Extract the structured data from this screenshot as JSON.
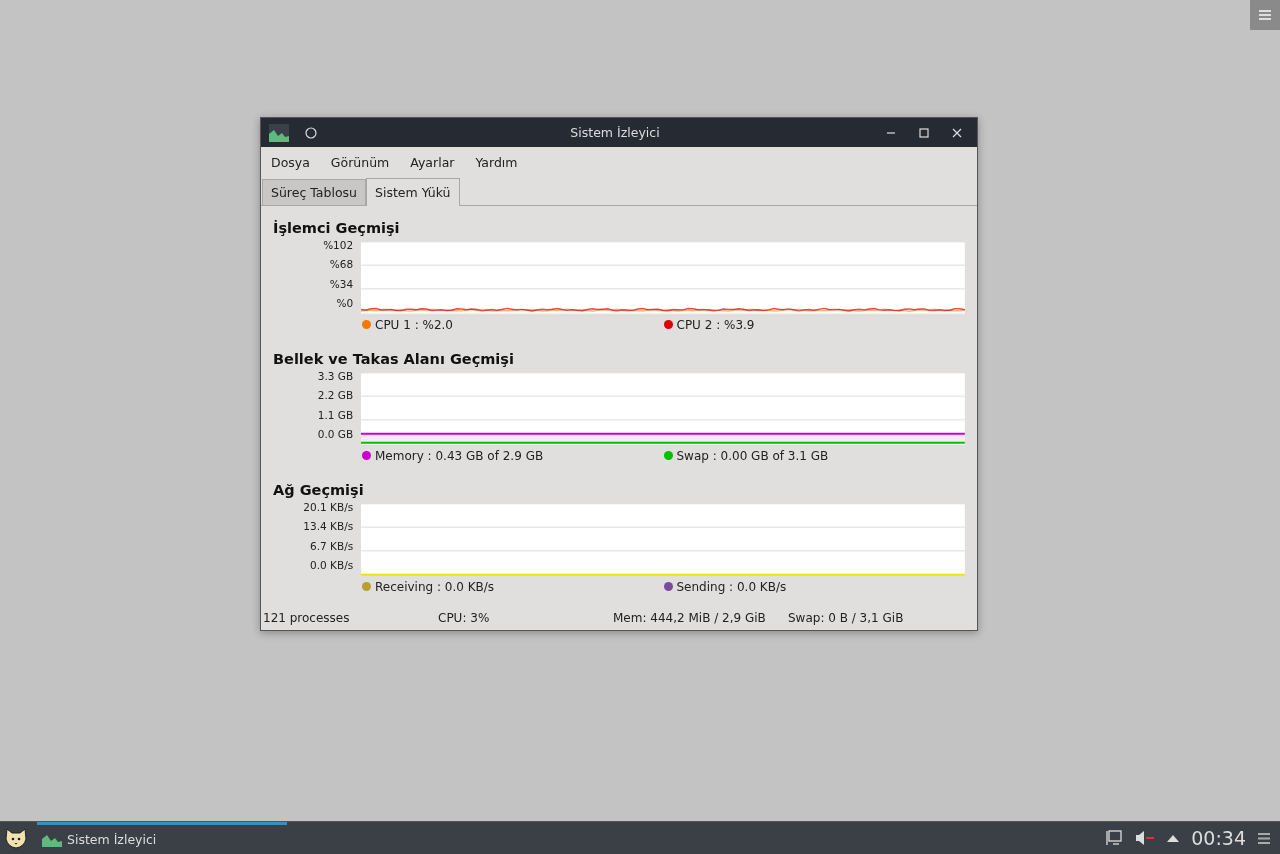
{
  "window": {
    "title": "Sistem İzleyici"
  },
  "menu": [
    "Dosya",
    "Görünüm",
    "Ayarlar",
    "Yardım"
  ],
  "tabs": [
    {
      "label": "Süreç Tablosu",
      "selected": false
    },
    {
      "label": "Sistem Yükü",
      "selected": true
    }
  ],
  "sections": [
    {
      "kind": "cpu",
      "title": "İşlemci Geçmişi",
      "y_ticks": [
        "%102",
        "%68",
        "%34",
        "%0"
      ],
      "legend": [
        {
          "label": "CPU 1 : %2.0",
          "color": "#f57900"
        },
        {
          "label": "CPU 2 : %3.9",
          "color": "#e00000"
        }
      ]
    },
    {
      "kind": "memory",
      "title": "Bellek ve Takas Alanı Geçmişi",
      "y_ticks": [
        "3.3 GB",
        "2.2 GB",
        "1.1 GB",
        "0.0 GB"
      ],
      "legend": [
        {
          "label": "Memory : 0.43 GB of 2.9 GB",
          "color": "#cc00cc"
        },
        {
          "label": "Swap : 0.00 GB of 3.1 GB",
          "color": "#00c000"
        }
      ]
    },
    {
      "kind": "network",
      "title": "Ağ Geçmişi",
      "y_ticks": [
        "20.1 KB/s",
        "13.4 KB/s",
        "6.7 KB/s",
        "0.0 KB/s"
      ],
      "legend": [
        {
          "label": "Receiving : 0.0 KB/s",
          "color": "#b5a030"
        },
        {
          "label": "Sending : 0.0 KB/s",
          "color": "#7c4a9c"
        }
      ]
    }
  ],
  "status_bar": [
    "121 processes",
    "CPU: 3%",
    "Mem: 444,2 MiB / 2,9 GiB",
    "Swap: 0 B / 3,1 GiB"
  ],
  "taskbar": {
    "tasks": [
      {
        "label": "Sistem İzleyici",
        "selected": true
      }
    ],
    "clock": "00:34"
  }
}
